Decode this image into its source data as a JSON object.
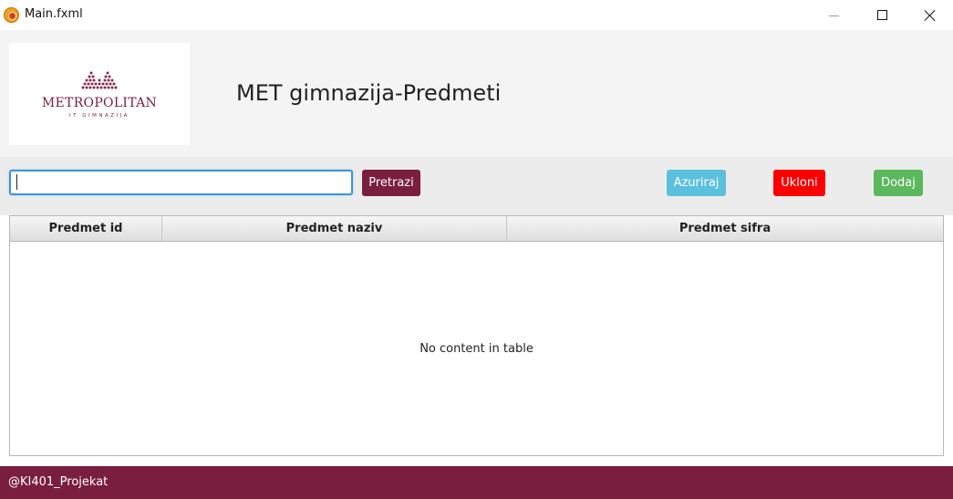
{
  "window": {
    "title": "Main.fxml",
    "icon": "javafx-app-icon",
    "controls": [
      "minimize-icon",
      "maximize-icon",
      "close-icon"
    ]
  },
  "header": {
    "logo": {
      "name": "METROPOLITAN",
      "subtitle": "IT GIMNAZIJA",
      "brand_color": "#7a1e3f"
    },
    "title": "MET gimnazija-Predmeti"
  },
  "toolbar": {
    "search": {
      "value": "",
      "placeholder": ""
    },
    "search_label": "Pretrazi",
    "update_label": "Azuriraj",
    "remove_label": "Ukloni",
    "add_label": "Dodaj"
  },
  "table": {
    "columns": [
      "Predmet id",
      "Predmet naziv",
      "Predmet sifra"
    ],
    "rows": [],
    "placeholder": "No content in table"
  },
  "footer": {
    "text": "@KI401_Projekat"
  },
  "colors": {
    "accent": "#7a1e3f",
    "update": "#5bc0de",
    "remove": "#ff0000",
    "add": "#5cb85c"
  }
}
